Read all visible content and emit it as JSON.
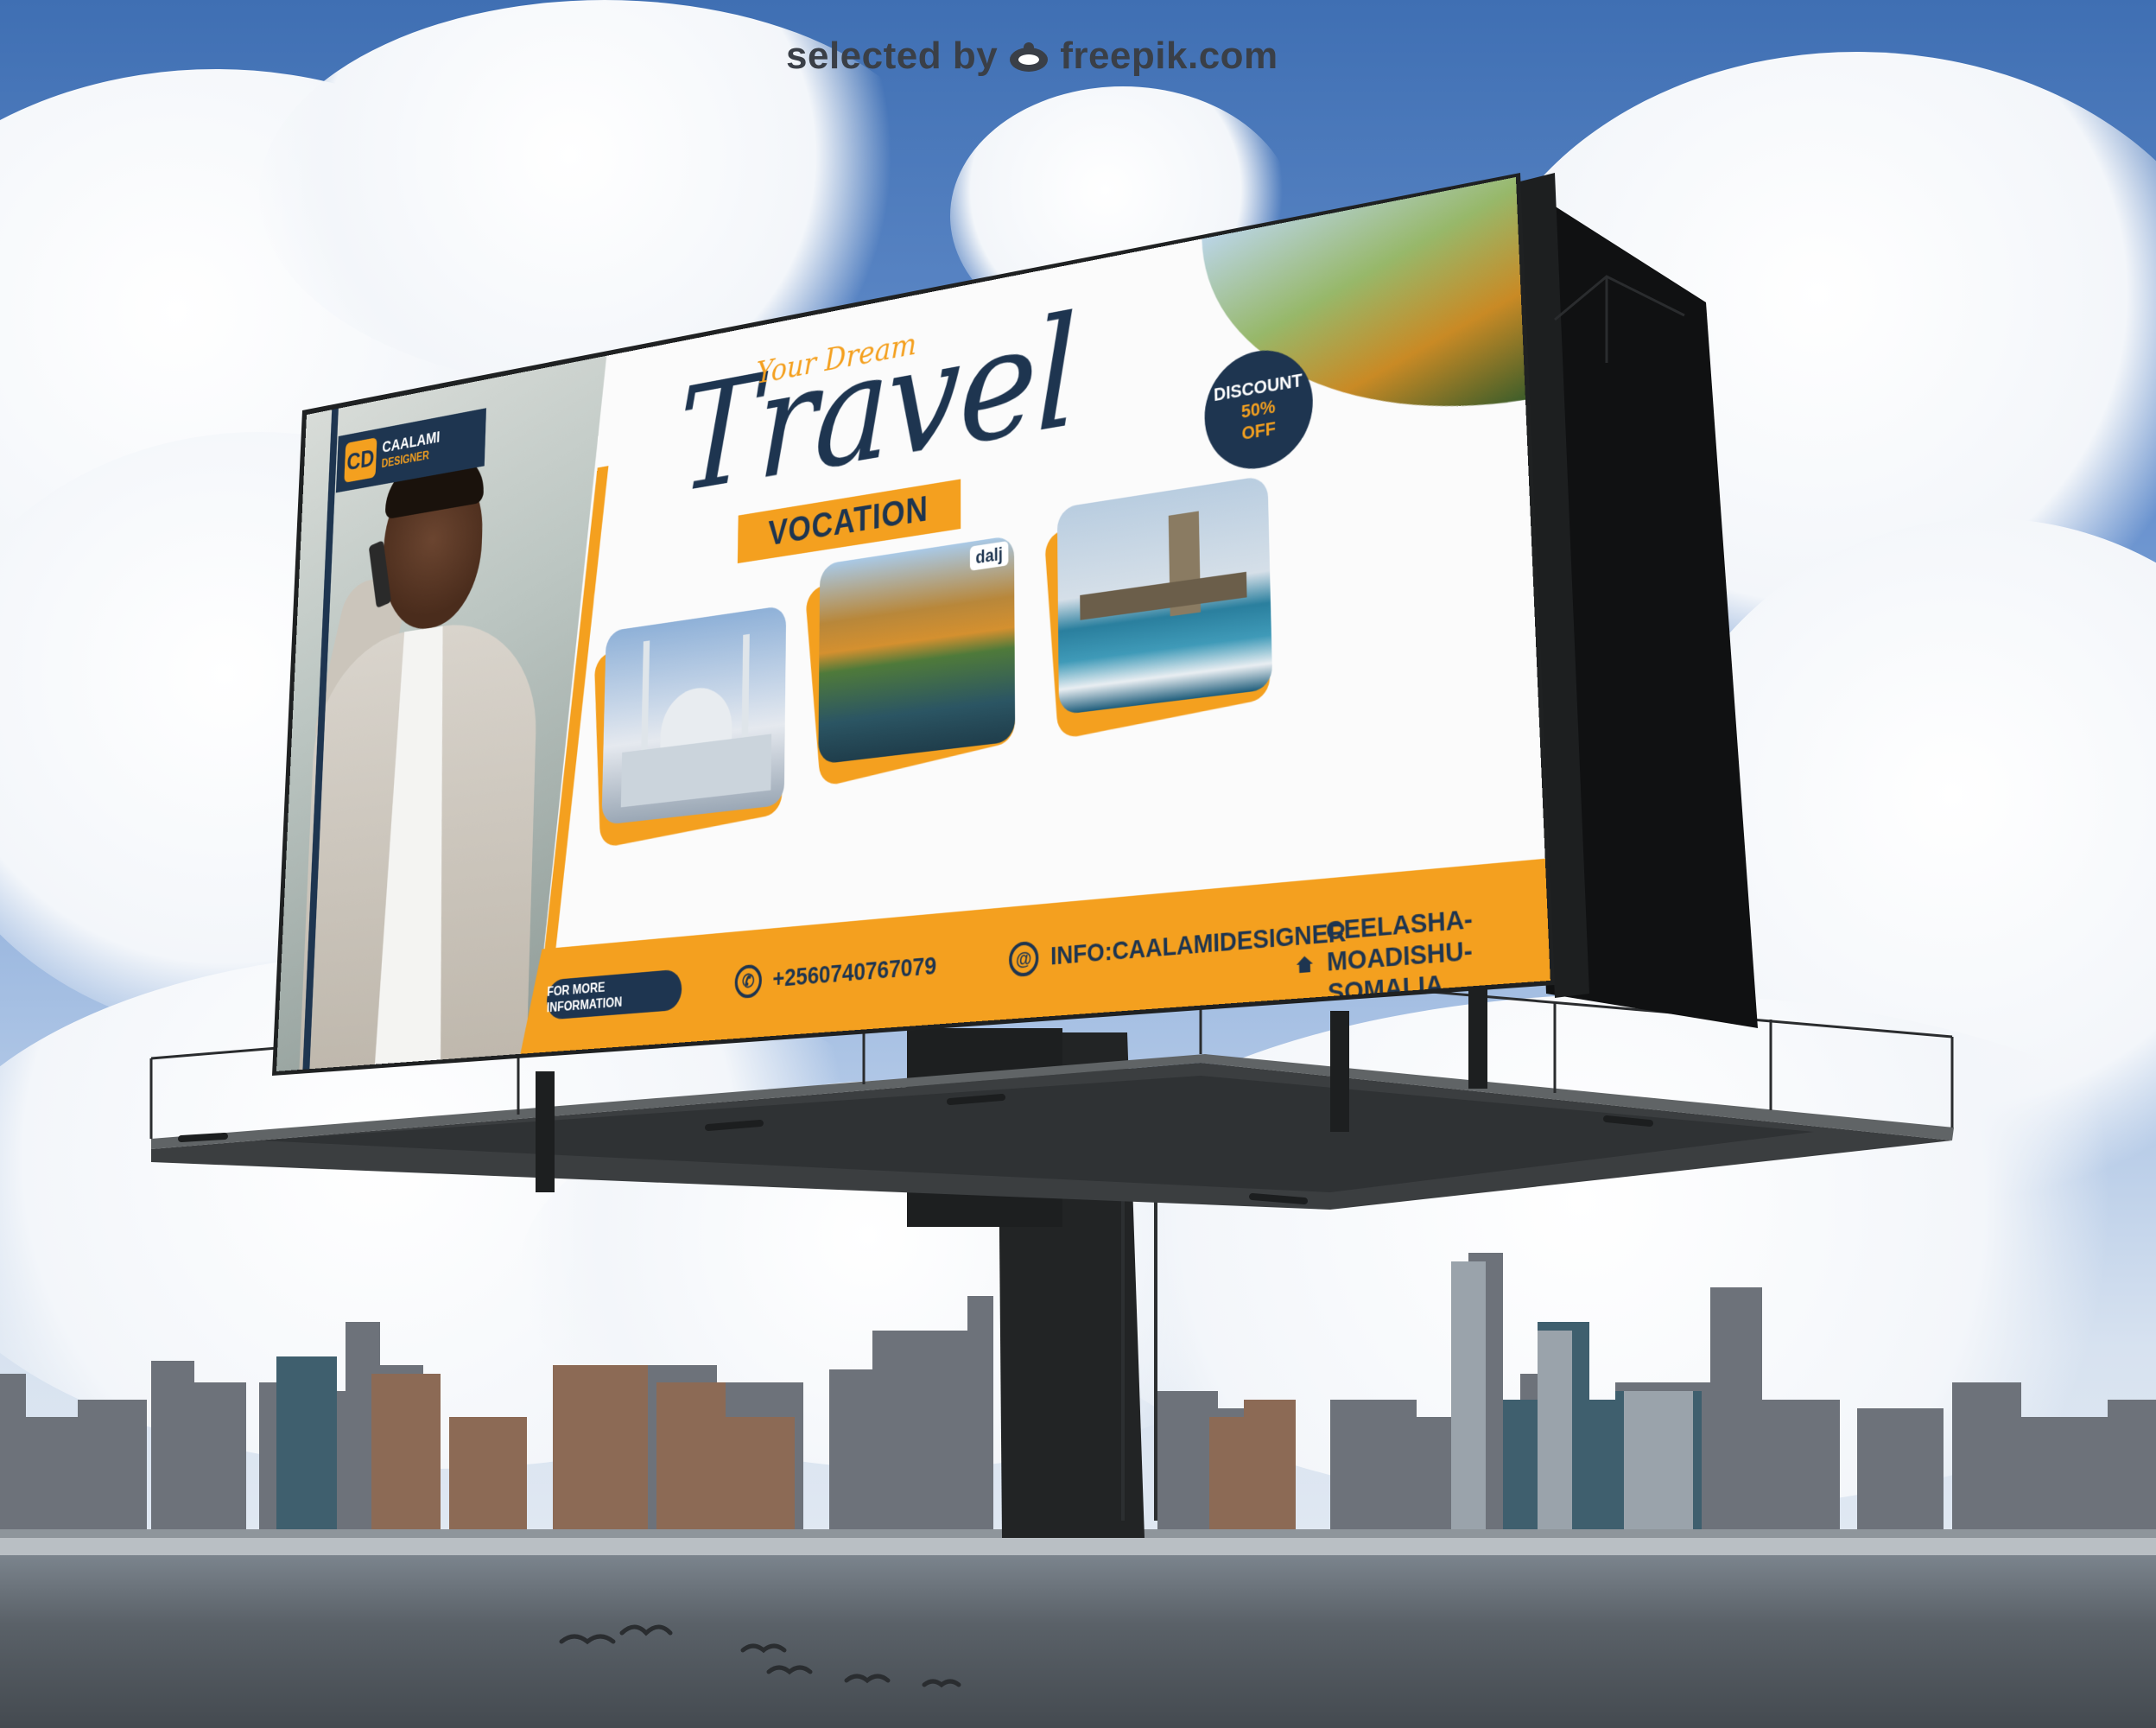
{
  "watermark": {
    "text": "selected by",
    "brand": "freepik.com"
  },
  "billboard": {
    "title_sub": "Your Dream",
    "title_main": "Travel",
    "vocation_label": "VOCATION",
    "brand_mark": "CD",
    "brand_name_line1": "CAALAMI",
    "brand_name_line2": "DESIGNER",
    "discount_label": "DISCOUNT",
    "discount_value": "50%",
    "discount_off": "OFF",
    "photo_tag": "dalj",
    "footer": {
      "more_info": "FOR MORE INFORMATION",
      "phone": "+2560740767079",
      "email": "INFO:CAALAMIDESIGNER",
      "address": "CEELASHA-MOADISHU-SOMALIA"
    }
  },
  "colors": {
    "accent": "#f4a01f",
    "navy": "#1e3550",
    "board": "#fbfbfb",
    "structure": "#222425"
  }
}
